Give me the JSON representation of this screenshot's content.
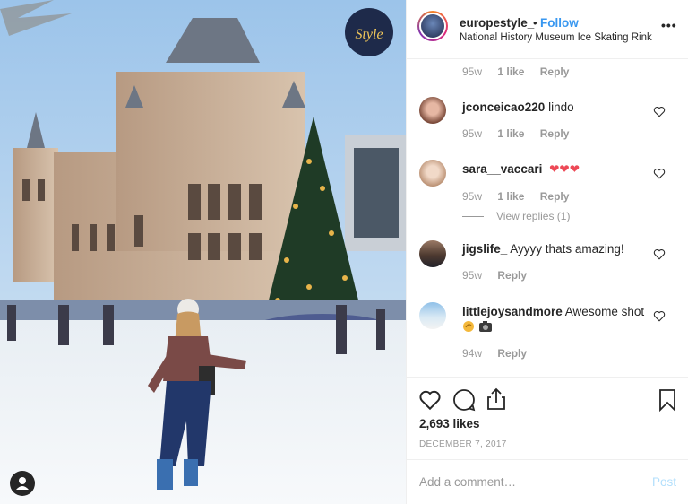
{
  "post": {
    "username": "europestyle_",
    "separator": "•",
    "follow_label": "Follow",
    "location": "National History Museum Ice Skating Rink",
    "more_label": "•••",
    "image_logo_text": "Style"
  },
  "comments": [
    {
      "username": "",
      "text": "",
      "time": "95w",
      "likes": "1 like",
      "reply": "Reply"
    },
    {
      "username": "jconceicao220",
      "text": "lindo",
      "time": "95w",
      "likes": "1 like",
      "reply": "Reply"
    },
    {
      "username": "sara__vaccari",
      "text": "❤❤❤",
      "time": "95w",
      "likes": "1 like",
      "reply": "Reply",
      "view_replies": "View replies (1)"
    },
    {
      "username": "jigslife_",
      "text": "Ayyyy thats amazing!",
      "time": "95w",
      "reply": "Reply"
    },
    {
      "username": "littlejoysandmore",
      "text": "Awesome shot",
      "time": "94w",
      "reply": "Reply"
    }
  ],
  "likes_label": "2,693 likes",
  "date": "DECEMBER 7, 2017",
  "add_comment_placeholder": "Add a comment…",
  "post_label": "Post",
  "colors": {
    "follow": "#3897f0",
    "meta": "#999999",
    "heart_emoji": "#ed4956"
  }
}
